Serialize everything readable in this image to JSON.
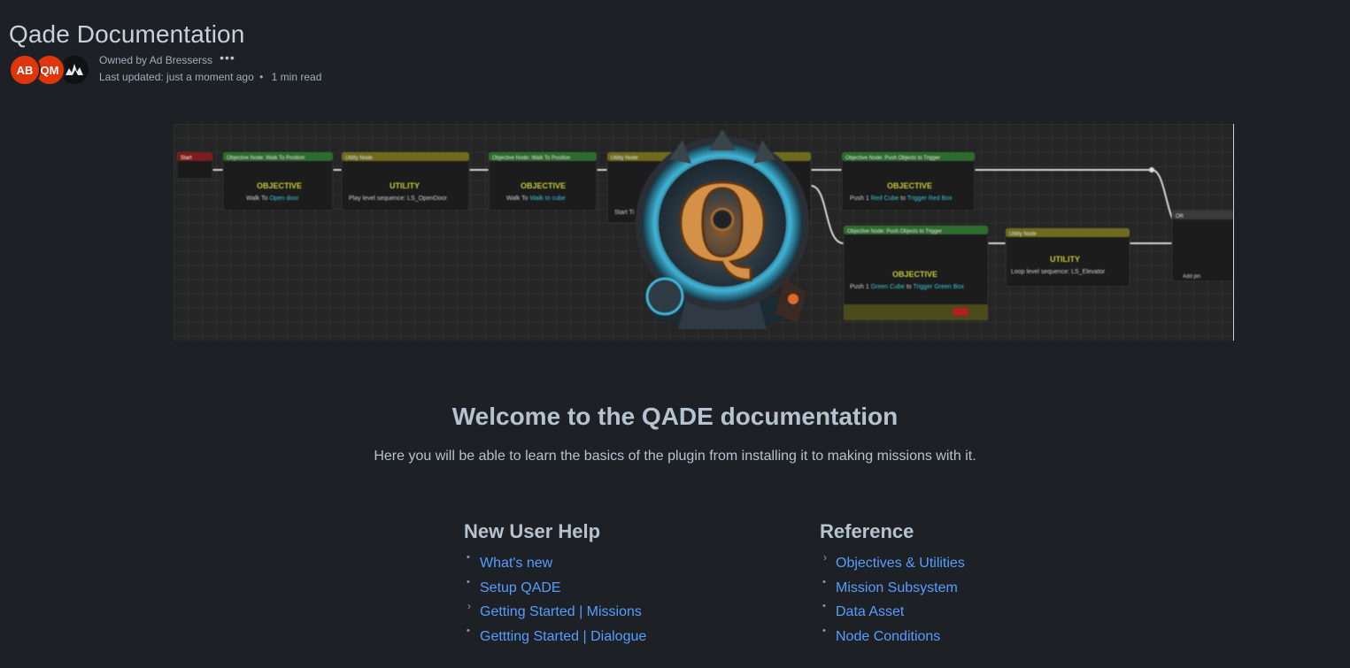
{
  "page": {
    "title": "Qade Documentation"
  },
  "byline": {
    "avatars": [
      {
        "initials": "AB",
        "color": "#de350b"
      },
      {
        "initials": "QM",
        "color": "#de350b"
      },
      {
        "icon": "qade-logo-icon"
      }
    ],
    "owner_text": "Owned by Ad Bresserss",
    "more_icon": "ellipsis-icon",
    "updated_text": "Last updated: just a moment ago",
    "separator": "•",
    "read_time": "1 min read"
  },
  "banner": {
    "logo_letter": "Q",
    "nodes": [
      {
        "header": "Start",
        "body": ""
      },
      {
        "header": "Objective Node: Walk To Position",
        "kind": "OBJECTIVE",
        "body": "Walk To Open door"
      },
      {
        "header": "Utility Node",
        "kind": "UTILITY",
        "body": "Play level sequence: LS_OpenDoor"
      },
      {
        "header": "Objective Node: Walk To Position",
        "kind": "OBJECTIVE",
        "body": "Walk To Walk to cube"
      },
      {
        "header": "Utility Node",
        "kind": "",
        "body": "Start Ti"
      },
      {
        "header": "Objective Node: Push Objects to Trigger",
        "kind": "OBJECTIVE",
        "body": "Push 1 Red Cube to Trigger Red Box"
      },
      {
        "header": "Objective Node: Push Objects to Trigger",
        "kind": "OBJECTIVE",
        "body": "Push 1 Green Cube to Trigger Green Box"
      },
      {
        "header": "Utility Node",
        "kind": "UTILITY",
        "body": "Loop level sequence: LS_Elevator"
      },
      {
        "header": "OR",
        "kind": "",
        "body": "Add pin"
      }
    ]
  },
  "content": {
    "welcome": "Welcome to the QADE documentation",
    "intro": "Here you will be able to learn the basics of the plugin from installing it to making missions with it.",
    "new_user": {
      "heading": "New User Help",
      "items": [
        {
          "label": "What's new",
          "marker": "bullet"
        },
        {
          "label": "Setup QADE",
          "marker": "bullet"
        },
        {
          "label": "Getting Started | Missions",
          "marker": "chevron"
        },
        {
          "label": "Gettting Started | Dialogue",
          "marker": "bullet"
        }
      ]
    },
    "reference": {
      "heading": "Reference",
      "items": [
        {
          "label": "Objectives & Utilities",
          "marker": "chevron"
        },
        {
          "label": "Mission Subsystem",
          "marker": "bullet"
        },
        {
          "label": "Data Asset",
          "marker": "bullet"
        },
        {
          "label": "Node Conditions",
          "marker": "bullet"
        }
      ]
    }
  },
  "colors": {
    "background": "#1d2125",
    "text": "#b6c2cf",
    "link": "#579dff",
    "avatar": "#de350b"
  }
}
